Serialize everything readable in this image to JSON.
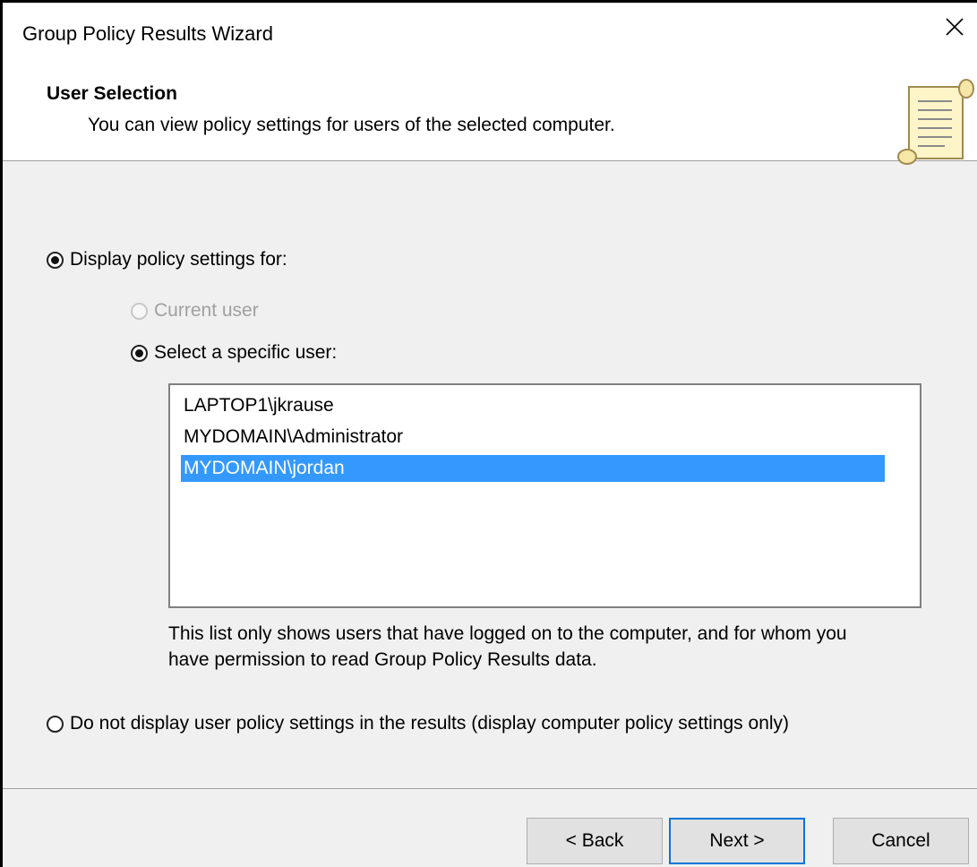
{
  "window": {
    "title": "Group Policy Results Wizard",
    "close_glyph": "✕"
  },
  "header": {
    "heading": "User Selection",
    "subheading": "You can view policy settings for users of the selected computer."
  },
  "options": {
    "display_for": {
      "label": "Display policy settings for:",
      "checked": true
    },
    "current_user": {
      "label": "Current user",
      "checked": false,
      "disabled": true
    },
    "specific_user": {
      "label": "Select a specific user:",
      "checked": true
    },
    "no_user": {
      "label": "Do not display user policy settings in the results (display computer policy settings only)",
      "checked": false
    }
  },
  "user_list": {
    "items": [
      {
        "label": "LAPTOP1\\jkrause",
        "selected": false
      },
      {
        "label": "MYDOMAIN\\Administrator",
        "selected": false
      },
      {
        "label": "MYDOMAIN\\jordan",
        "selected": true
      }
    ],
    "note_line1": "This list only shows users that have logged on to the computer, and for whom you",
    "note_line2": "have permission to read Group Policy Results data."
  },
  "buttons": {
    "back": "< Back",
    "next": "Next >",
    "cancel": "Cancel"
  },
  "colors": {
    "selection": "#3399ff",
    "default_button_border": "#0078d7",
    "dialog_background": "#f0f0f0"
  },
  "icons": {
    "header_icon": "scroll-document-icon",
    "close": "close-icon"
  }
}
